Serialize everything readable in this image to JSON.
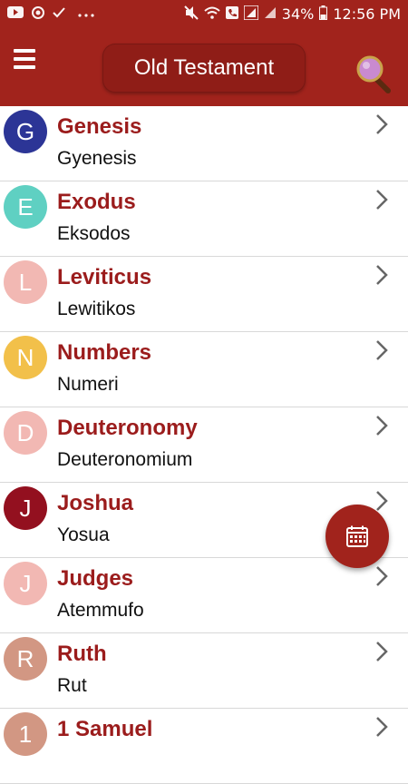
{
  "statusbar": {
    "battery_percent": "34%",
    "time": "12:56 PM",
    "icons": [
      "youtube-icon",
      "sync-icon",
      "check-icon",
      "more-dots-icon",
      "mute-icon",
      "wifi-icon",
      "call-icon",
      "signal-icon",
      "battery-icon"
    ]
  },
  "appbar": {
    "title": "Old Testament",
    "menu_icon": "hamburger-menu-icon",
    "search_icon": "magnifier-search-icon",
    "color": "#a1231c"
  },
  "books": [
    {
      "letter": "G",
      "name": "Genesis",
      "alt": "Gyenesis",
      "color": "#2c3596"
    },
    {
      "letter": "E",
      "name": "Exodus",
      "alt": "Eksodos",
      "color": "#5fd0c2"
    },
    {
      "letter": "L",
      "name": "Leviticus",
      "alt": "Lewitikos",
      "color": "#f2b8b3"
    },
    {
      "letter": "N",
      "name": "Numbers",
      "alt": "Numeri",
      "color": "#f2c04a"
    },
    {
      "letter": "D",
      "name": "Deuteronomy",
      "alt": "Deuteronomium",
      "color": "#f2b8b3"
    },
    {
      "letter": "J",
      "name": "Joshua",
      "alt": "Yosua",
      "color": "#93101f"
    },
    {
      "letter": "J",
      "name": "Judges",
      "alt": "Atemmufo",
      "color": "#f2b8b3"
    },
    {
      "letter": "R",
      "name": "Ruth",
      "alt": "Rut",
      "color": "#d29783"
    },
    {
      "letter": "1",
      "name": "1 Samuel",
      "alt": "",
      "color": "#d29783"
    }
  ],
  "fab": {
    "icon": "calendar-icon"
  }
}
